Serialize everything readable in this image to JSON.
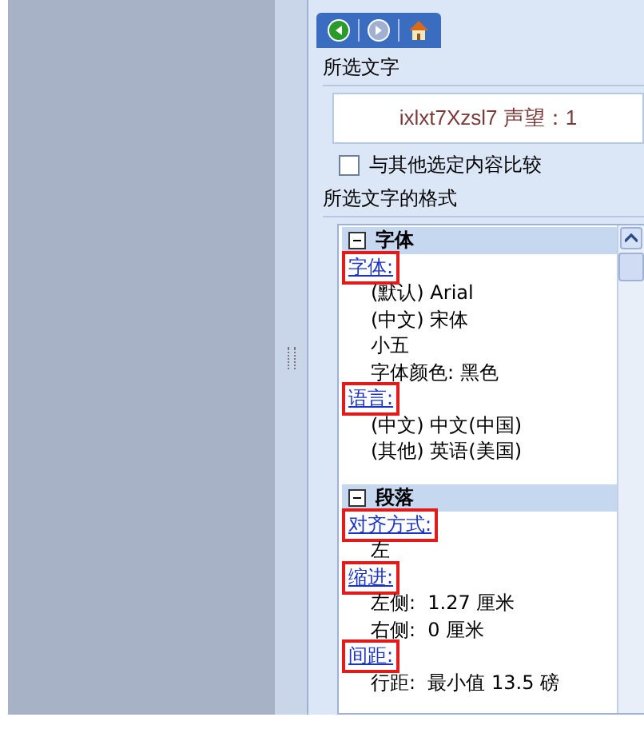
{
  "toolbar": {
    "buttons": [
      {
        "kind": "back"
      },
      {
        "kind": "forward",
        "disabled": true
      },
      {
        "kind": "home"
      }
    ]
  },
  "selected_text": {
    "label": "所选文字",
    "value": "ixlxt7Xzsl7 声望：1"
  },
  "compare": {
    "label": "与其他选定内容比较",
    "checked": false
  },
  "format": {
    "label": "所选文字的格式",
    "sections": [
      {
        "title": "字体",
        "expanded": true,
        "items": [
          {
            "kind": "link",
            "text": "字体:",
            "annotated": true
          },
          {
            "kind": "value",
            "text": "(默认) Arial"
          },
          {
            "kind": "value",
            "text": "(中文) 宋体"
          },
          {
            "kind": "value",
            "text": "小五"
          },
          {
            "kind": "value",
            "text": "字体颜色: 黑色"
          },
          {
            "kind": "link",
            "text": "语言:",
            "annotated": true
          },
          {
            "kind": "value",
            "text": "(中文) 中文(中国)"
          },
          {
            "kind": "value",
            "text": "(其他) 英语(美国)"
          }
        ]
      },
      {
        "title": "段落",
        "expanded": true,
        "items": [
          {
            "kind": "link",
            "text": "对齐方式:",
            "annotated": true
          },
          {
            "kind": "value",
            "text": "左"
          },
          {
            "kind": "link",
            "text": "缩进:",
            "annotated": true
          },
          {
            "kind": "value",
            "text": "左侧:  1.27 厘米"
          },
          {
            "kind": "value",
            "text": "右侧:  0 厘米"
          },
          {
            "kind": "link",
            "text": "间距:",
            "annotated": true
          },
          {
            "kind": "value",
            "text": "行距:  最小值 13.5 磅"
          }
        ]
      }
    ]
  }
}
